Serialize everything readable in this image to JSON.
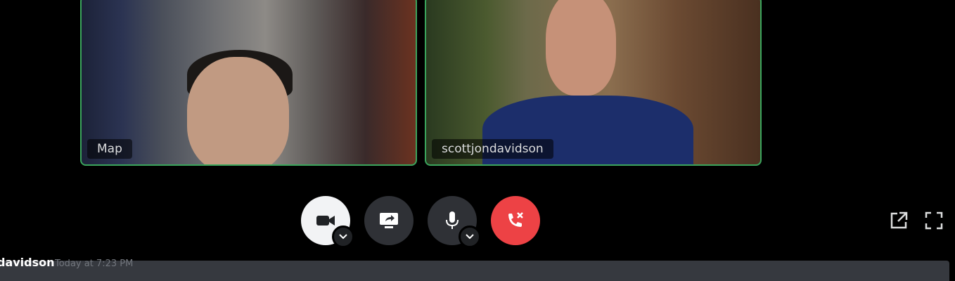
{
  "tiles": [
    {
      "name": "Map"
    },
    {
      "name": "scottjondavidson"
    }
  ],
  "controls": {
    "video": "video-camera-icon",
    "screen_share": "screen-share-icon",
    "microphone": "microphone-icon",
    "disconnect": "disconnect-icon"
  },
  "corner": {
    "popout": "popout-icon",
    "fullscreen": "fullscreen-icon"
  },
  "message": {
    "username": "davidson",
    "timestamp": "Today at 7:23 PM"
  },
  "colors": {
    "speaking_border": "#3ba55c",
    "leave_button": "#ed4245",
    "dark_button": "#2f3136"
  }
}
